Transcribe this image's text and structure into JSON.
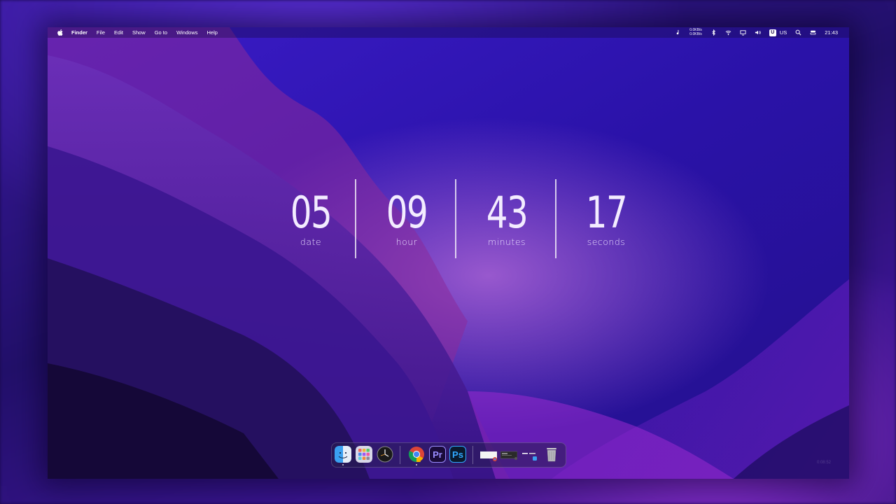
{
  "menubar": {
    "app_name": "Finder",
    "menus": [
      "File",
      "Edit",
      "Show",
      "Go to",
      "Windows",
      "Help"
    ],
    "network_up": "0.0KB/s",
    "network_down": "0.0KB/s",
    "input_badge": "U",
    "input_source": "US",
    "time": "21:43",
    "icons": [
      "apple-icon",
      "music-note-icon",
      "bluetooth-icon",
      "wifi-icon",
      "display-icon",
      "volume-icon",
      "search-icon",
      "control-center-icon"
    ]
  },
  "clock": {
    "units": [
      {
        "value": "05",
        "label": "date"
      },
      {
        "value": "09",
        "label": "hour"
      },
      {
        "value": "43",
        "label": "minutes"
      },
      {
        "value": "17",
        "label": "seconds"
      }
    ]
  },
  "dock": {
    "apps": [
      "finder-icon",
      "launchpad-icon",
      "clock-app-icon",
      "chrome-icon",
      "premiere-pro-icon",
      "photoshop-icon",
      "window-thumbnail",
      "window-thumbnail",
      "window-thumbnail",
      "trash-icon"
    ],
    "premiere_label": "Pr",
    "photoshop_label": "Ps"
  },
  "watermark": "0:08:52",
  "colors": {
    "accent": "#3f1fc0",
    "text": "#f3ecff"
  }
}
